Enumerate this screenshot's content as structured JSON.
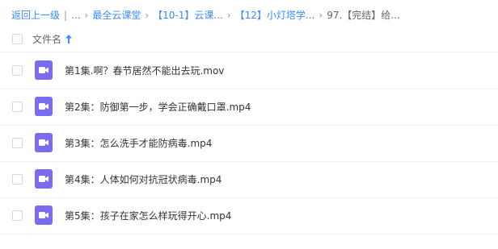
{
  "breadcrumb": {
    "back": "返回上一级",
    "ellipsis": "...",
    "items": [
      "最全云课堂",
      "【10-1】云课...",
      "【12】小灯塔学..."
    ],
    "current": "97.【完结】给..."
  },
  "header": {
    "name_label": "文件名",
    "sort_icon": "arrow-up-icon"
  },
  "files": [
    {
      "name": "第1集.啊？春节居然不能出去玩.mov",
      "icon": "video-file-icon"
    },
    {
      "name": "第2集：防御第一步，学会正确戴口罩.mp4",
      "icon": "video-file-icon"
    },
    {
      "name": "第3集：怎么洗手才能防病毒.mp4",
      "icon": "video-file-icon"
    },
    {
      "name": "第4集：人体如何对抗冠状病毒.mp4",
      "icon": "video-file-icon"
    },
    {
      "name": "第5集：孩子在家怎么样玩得开心.mp4",
      "icon": "video-file-icon"
    }
  ],
  "colors": {
    "link": "#3b8cff",
    "video_icon": "#7a6cf0"
  }
}
